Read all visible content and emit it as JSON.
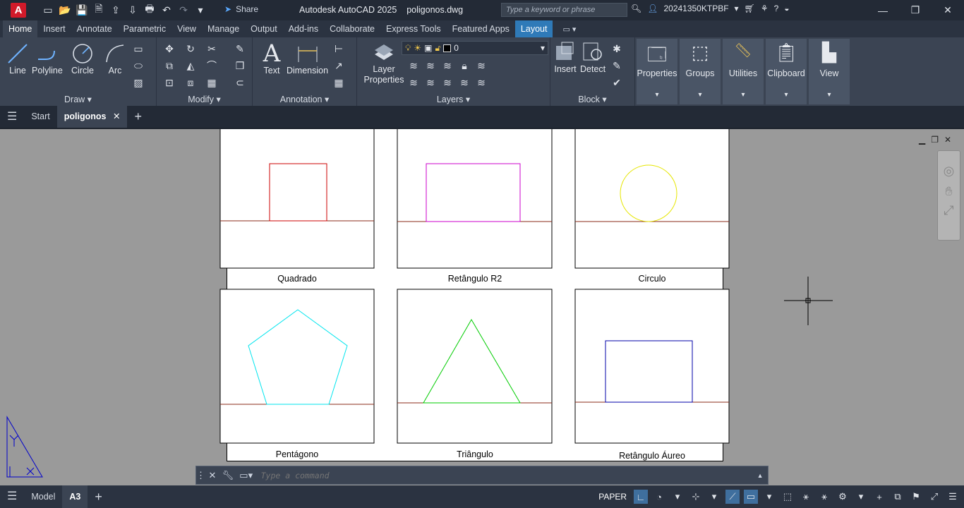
{
  "title_bar": {
    "app_name": "Autodesk AutoCAD 2025",
    "file_name": "poligonos.dwg",
    "share_label": "Share",
    "search_placeholder": "Type a keyword or phrase",
    "user": "20241350KTPBF",
    "logo": "A"
  },
  "ribbon_tabs": [
    "Home",
    "Insert",
    "Annotate",
    "Parametric",
    "View",
    "Manage",
    "Output",
    "Add-ins",
    "Collaborate",
    "Express Tools",
    "Featured Apps",
    "Layout"
  ],
  "ribbon": {
    "draw": {
      "label": "Draw",
      "line": "Line",
      "polyline": "Polyline",
      "circle": "Circle",
      "arc": "Arc"
    },
    "modify": {
      "label": "Modify"
    },
    "annotation": {
      "label": "Annotation",
      "text": "Text",
      "dimension": "Dimension"
    },
    "layers": {
      "label": "Layers",
      "layer_properties": "Layer Properties",
      "current_layer": "0"
    },
    "block": {
      "label": "Block",
      "insert": "Insert",
      "detect": "Detect"
    },
    "properties": "Properties",
    "groups": "Groups",
    "utilities": "Utilities",
    "clipboard": "Clipboard",
    "view": "View"
  },
  "doc_tabs": {
    "start": "Start",
    "active": "poligonos"
  },
  "drawing": {
    "captions": {
      "quadrado": "Quadrado",
      "retangulo_r2": "Retângulo R2",
      "circulo": "Circulo",
      "pentagono": "Pentágono",
      "triangulo": "Triângulo",
      "retangulo_aureo": "Retângulo Áureo"
    },
    "colors": {
      "square": "#cc0000",
      "rect_r2": "#cc00cc",
      "circle": "#e6e600",
      "pentagon": "#00e5ee",
      "triangle": "#00cc00",
      "golden": "#0000aa",
      "baseline": "#8b2b1a"
    }
  },
  "command_line": {
    "placeholder": "Type a command"
  },
  "status_bar": {
    "model": "Model",
    "layout": "A3",
    "paper": "PAPER"
  }
}
